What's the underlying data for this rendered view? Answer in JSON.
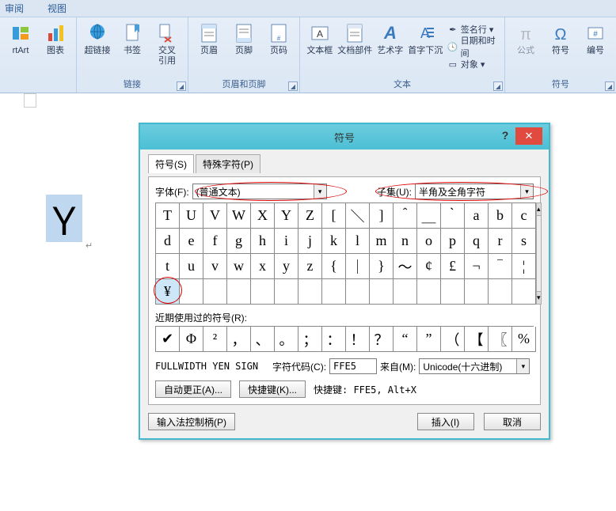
{
  "menu": {
    "review": "审阅",
    "view": "视图"
  },
  "ribbon": {
    "groups": {
      "illustrations": {
        "items": {
          "smartart": "rtArt",
          "chart": "图表"
        }
      },
      "links": {
        "label": "链接",
        "items": {
          "hyperlink": "超链接",
          "bookmark": "书签",
          "crossref": "交叉\n引用"
        }
      },
      "headerfooter": {
        "label": "页眉和页脚",
        "items": {
          "header": "页眉",
          "footer": "页脚",
          "pagenum": "页码"
        }
      },
      "text": {
        "label": "文本",
        "items": {
          "textbox": "文本框",
          "parts": "文档部件",
          "wordart": "艺术字",
          "dropcap": "首字下沉"
        },
        "small": {
          "signature": "签名行",
          "datetime": "日期和时间",
          "object": "对象"
        }
      },
      "symbols": {
        "label": "符号",
        "items": {
          "equation": "公式",
          "symbol": "符号",
          "number": "编号"
        }
      }
    }
  },
  "doc": {
    "selected_glyph": "Ｙ",
    "cursor_mark": "↵"
  },
  "dialog": {
    "title": "符号",
    "tabs": {
      "symbols": "符号(S)",
      "special": "特殊字符(P)"
    },
    "font_label": "字体(F):",
    "font_value": "(普通文本)",
    "subset_label": "子集(U):",
    "subset_value": "半角及全角字符",
    "grid": {
      "rows": [
        [
          "T",
          "U",
          "V",
          "W",
          "X",
          "Y",
          "Z",
          "[",
          "＼",
          "]",
          "＾",
          "＿",
          "｀",
          "a",
          "b",
          "c"
        ],
        [
          "d",
          "e",
          "f",
          "g",
          "h",
          "i",
          "j",
          "k",
          "l",
          "m",
          "n",
          "o",
          "p",
          "q",
          "r",
          "s"
        ],
        [
          "t",
          "u",
          "v",
          "w",
          "x",
          "y",
          "z",
          "{",
          "｜",
          "}",
          "～",
          "¢",
          "£",
          "¬",
          "‾",
          "¦"
        ],
        [
          "¥",
          "",
          "",
          "",
          "",
          "",
          "",
          "",
          "",
          "",
          "",
          "",
          "",
          "",
          "",
          ""
        ]
      ],
      "selected": {
        "r": 3,
        "c": 0
      }
    },
    "recent_label": "近期使用过的符号(R):",
    "recent": [
      "✔",
      "Φ",
      "²",
      "，",
      "、",
      "。",
      "；",
      "：",
      "！",
      "？",
      "“",
      "”",
      "（",
      "【",
      "〖",
      "%"
    ],
    "charname": "FULLWIDTH YEN SIGN",
    "code_label": "字符代码(C):",
    "code_value": "FFE5",
    "from_label": "来自(M):",
    "from_value": "Unicode(十六进制)",
    "autocorrect": "自动更正(A)...",
    "shortcut_btn": "快捷键(K)...",
    "shortcut_label": "快捷键: FFE5, Alt+X",
    "ime": "输入法控制柄(P)",
    "insert": "插入(I)",
    "cancel": "取消",
    "help": "?",
    "close": "✕"
  },
  "chart_data": null
}
